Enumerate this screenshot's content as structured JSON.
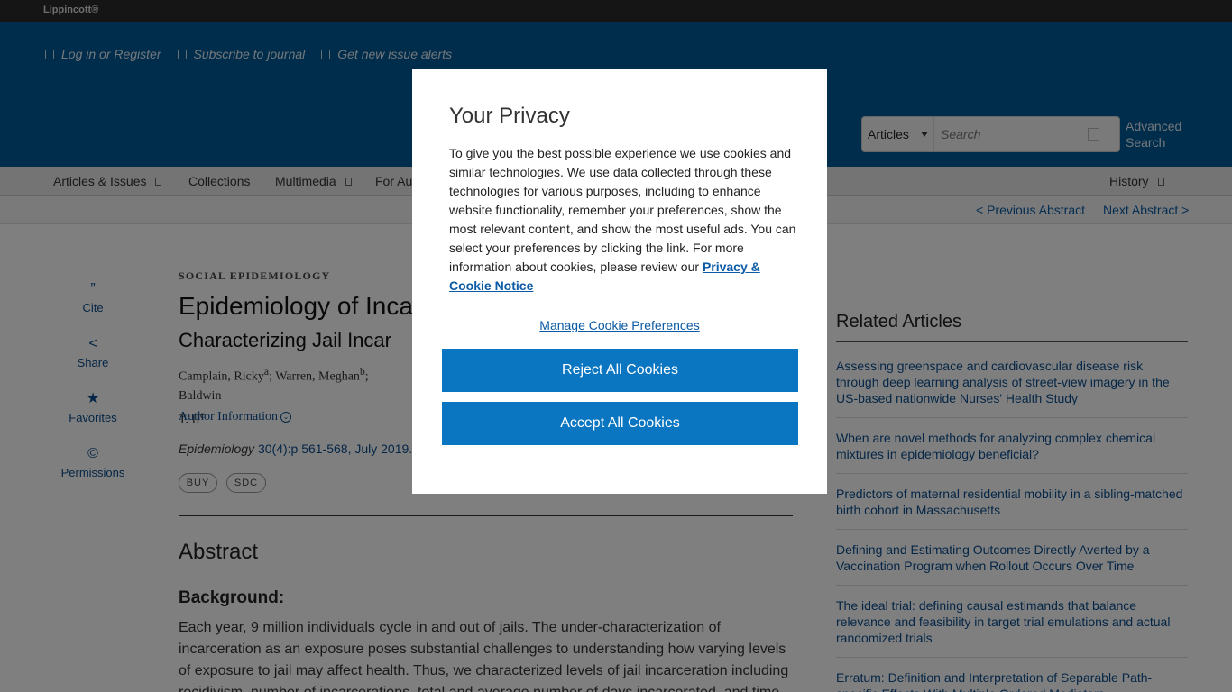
{
  "topbar": {
    "brand": "Lippincott®"
  },
  "header": {
    "links": [
      {
        "label": "Log in or Register"
      },
      {
        "label": "Subscribe to journal"
      },
      {
        "label": "Get new issue alerts"
      }
    ],
    "search": {
      "scope": "Articles",
      "placeholder": "Search",
      "advanced": "Advanced Search"
    }
  },
  "nav": {
    "items": [
      "Articles & Issues",
      "Collections",
      "Multimedia",
      "For Au"
    ],
    "history": "History"
  },
  "subnav": {
    "prev": "< Previous Abstract",
    "next": "Next Abstract >"
  },
  "sidebar": {
    "tools": [
      {
        "label": "Cite",
        "icon": "quote-icon"
      },
      {
        "label": "Share",
        "icon": "share-icon"
      },
      {
        "label": "Favorites",
        "icon": "star-icon"
      },
      {
        "label": "Permissions",
        "icon": "copyright-icon"
      }
    ]
  },
  "article": {
    "section": "SOCIAL EPIDEMIOLOGY",
    "title": "Epidemiology of Inca",
    "subtitle": "Characterizing Jail Incar",
    "authors_line1": "Camplain, Ricky",
    "authors_sup1": "a",
    "authors_mid": "; Warren, Meghan",
    "authors_sup2": "b",
    "authors_tail": "; Baldwin",
    "authors_line2": "T. II",
    "authors_sup3": "e",
    "author_info": "Author Information",
    "journal": "Epidemiology",
    "citation": "30(4):p 561-568, July 2019.",
    "pills": [
      "BUY",
      "SDC"
    ],
    "abstract_heading": "Abstract",
    "background_heading": "Background:",
    "background_text": "Each year, 9 million individuals cycle in and out of jails. The under-characterization of incarceration as an exposure poses substantial challenges to understanding how varying levels of exposure to jail may affect health. Thus, we characterized levels of jail incarceration including recidivism, number of incarcerations, total and average number of days incarcerated, and time"
  },
  "related": {
    "heading": "Related Articles",
    "items": [
      "Assessing greenspace and cardiovascular disease risk through deep learning analysis of street-view imagery in the US-based nationwide Nurses' Health Study",
      "When are novel methods for analyzing complex chemical mixtures in epidemiology beneficial?",
      "Predictors of maternal residential mobility in a sibling-matched birth cohort in Massachusetts",
      "Defining and Estimating Outcomes Directly Averted by a Vaccination Program when Rollout Occurs Over Time",
      "The ideal trial: defining causal estimands that balance relevance and feasibility in target trial emulations and actual randomized trials",
      "Erratum: Definition and Interpretation of Separable Path-specific Effects With Multiple Ordered Mediators"
    ]
  },
  "modal": {
    "title": "Your Privacy",
    "description": "To give you the best possible experience we use cookies and similar technologies. We use data collected through these technologies for various purposes, including to enhance website functionality, remember your preferences, show the most relevant content, and show the most useful ads. You can select your preferences by clicking the link. For more information about cookies, please review our ",
    "notice_link": "Privacy & Cookie Notice",
    "manage": "Manage Cookie Preferences",
    "reject": "Reject All Cookies",
    "accept": "Accept All Cookies"
  }
}
